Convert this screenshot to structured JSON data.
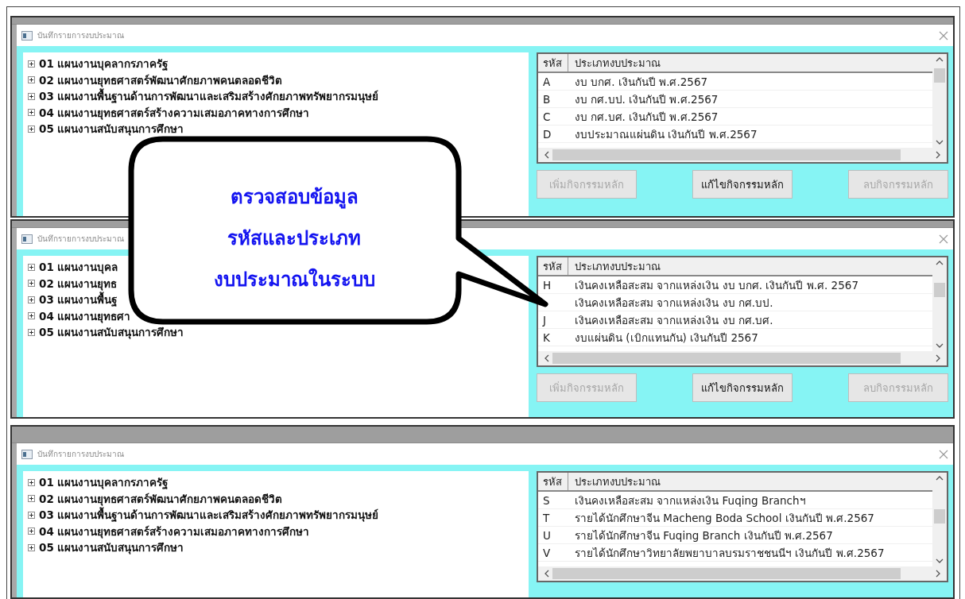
{
  "windows": [
    {
      "title": "บันทึกรายการงบประมาณ",
      "tree": [
        {
          "label": "01 แผนงานบุคลากรภาครัฐ",
          "expanded": false
        },
        {
          "label": "02 แผนงานยุทธศาสตร์พัฒนาศักยภาพคนตลอดชีวิต",
          "expanded": false
        },
        {
          "label": "03 แผนงานพื้นฐานด้านการพัฒนาและเสริมสร้างศักยภาพทรัพยากรมนุษย์",
          "expanded": false
        },
        {
          "label": "04 แผนงานยุทธศาสตร์สร้างความเสมอภาคทางการศึกษา",
          "expanded": false
        },
        {
          "label": "05 แผนงานสนับสนุนการศึกษา",
          "expanded": false
        }
      ],
      "list": {
        "columns": [
          "รหัส",
          "ประเภทงบประมาณ"
        ],
        "rows": [
          {
            "code": "A",
            "name": "งบ บกศ. เงินกันปี พ.ศ.2567"
          },
          {
            "code": "B",
            "name": "งบ กศ.บป. เงินกันปี พ.ศ.2567"
          },
          {
            "code": "C",
            "name": "งบ กศ.บศ. เงินกันปี พ.ศ.2567"
          },
          {
            "code": "D",
            "name": "งบประมาณแผ่นดิน เงินกันปี พ.ศ.2567"
          }
        ]
      },
      "buttons": [
        {
          "label": "เพิ่มกิจกรรมหลัก",
          "disabled": true
        },
        {
          "label": "แก้ไขกิจกรรมหลัก",
          "disabled": false
        },
        {
          "label": "ลบกิจกรรมหลัก",
          "disabled": true
        }
      ]
    },
    {
      "title": "บันทึกรายการงบประมาณ",
      "tree": [
        {
          "label": "01 แผนงานบุคล",
          "expanded": false
        },
        {
          "label": "02 แผนงานยุทธ",
          "expanded": false
        },
        {
          "label": "03 แผนงานพื้นฐ",
          "expanded": false
        },
        {
          "label": "04 แผนงานยุทธศา",
          "expanded": false
        },
        {
          "label": "05 แผนงานสนับสนุนการศึกษา",
          "expanded": false
        }
      ],
      "list": {
        "columns": [
          "รหัส",
          "ประเภทงบประมาณ"
        ],
        "rows": [
          {
            "code": "H",
            "name": "เงินคงเหลือสะสม จากแหล่งเงิน งบ บกศ. เงินกันปี พ.ศ. 2567"
          },
          {
            "name": "เงินคงเหลือสะสม จากแหล่งเงิน งบ กศ.บป."
          },
          {
            "code": "J",
            "name": "เงินคงเหลือสะสม จากแหล่งเงิน งบ กศ.บศ."
          },
          {
            "code": "K",
            "name": "งบแผ่นดิน (เบิกแทนกัน) เงินกันปี 2567"
          }
        ]
      },
      "buttons": [
        {
          "label": "เพิ่มกิจกรรมหลัก",
          "disabled": true
        },
        {
          "label": "แก้ไขกิจกรรมหลัก",
          "disabled": false
        },
        {
          "label": "ลบกิจกรรมหลัก",
          "disabled": true
        }
      ]
    },
    {
      "title": "บันทึกรายการงบประมาณ",
      "tree": [
        {
          "label": "01 แผนงานบุคลากรภาครัฐ",
          "expanded": false
        },
        {
          "label": "02 แผนงานยุทธศาสตร์พัฒนาศักยภาพคนตลอดชีวิต",
          "expanded": false
        },
        {
          "label": "03 แผนงานพื้นฐานด้านการพัฒนาและเสริมสร้างศักยภาพทรัพยากรมนุษย์",
          "expanded": false
        },
        {
          "label": "04 แผนงานยุทธศาสตร์สร้างความเสมอภาคทางการศึกษา",
          "expanded": false
        },
        {
          "label": "05 แผนงานสนับสนุนการศึกษา",
          "expanded": false
        }
      ],
      "list": {
        "columns": [
          "รหัส",
          "ประเภทงบประมาณ"
        ],
        "rows": [
          {
            "code": "S",
            "name": "เงินคงเหลือสะสม จากแหล่งเงิน Fuqing Branchฯ"
          },
          {
            "code": "T",
            "name": "รายได้นักศึกษาจีน Macheng Boda School เงินกันปี พ.ศ.2567"
          },
          {
            "code": "U",
            "name": "รายได้นักศึกษาจีน Fuqing Branch เงินกันปี พ.ศ.2567"
          },
          {
            "code": "V",
            "name": "รายได้นักศึกษาวิทยาลัยพยาบาลบรมราชชนนีฯ เงินกันปี พ.ศ.2567"
          }
        ]
      }
    }
  ],
  "callout": {
    "lines": [
      "ตรวจสอบข้อมูล",
      "รหัสและประเภท",
      "งบประมาณในระบบ"
    ]
  }
}
